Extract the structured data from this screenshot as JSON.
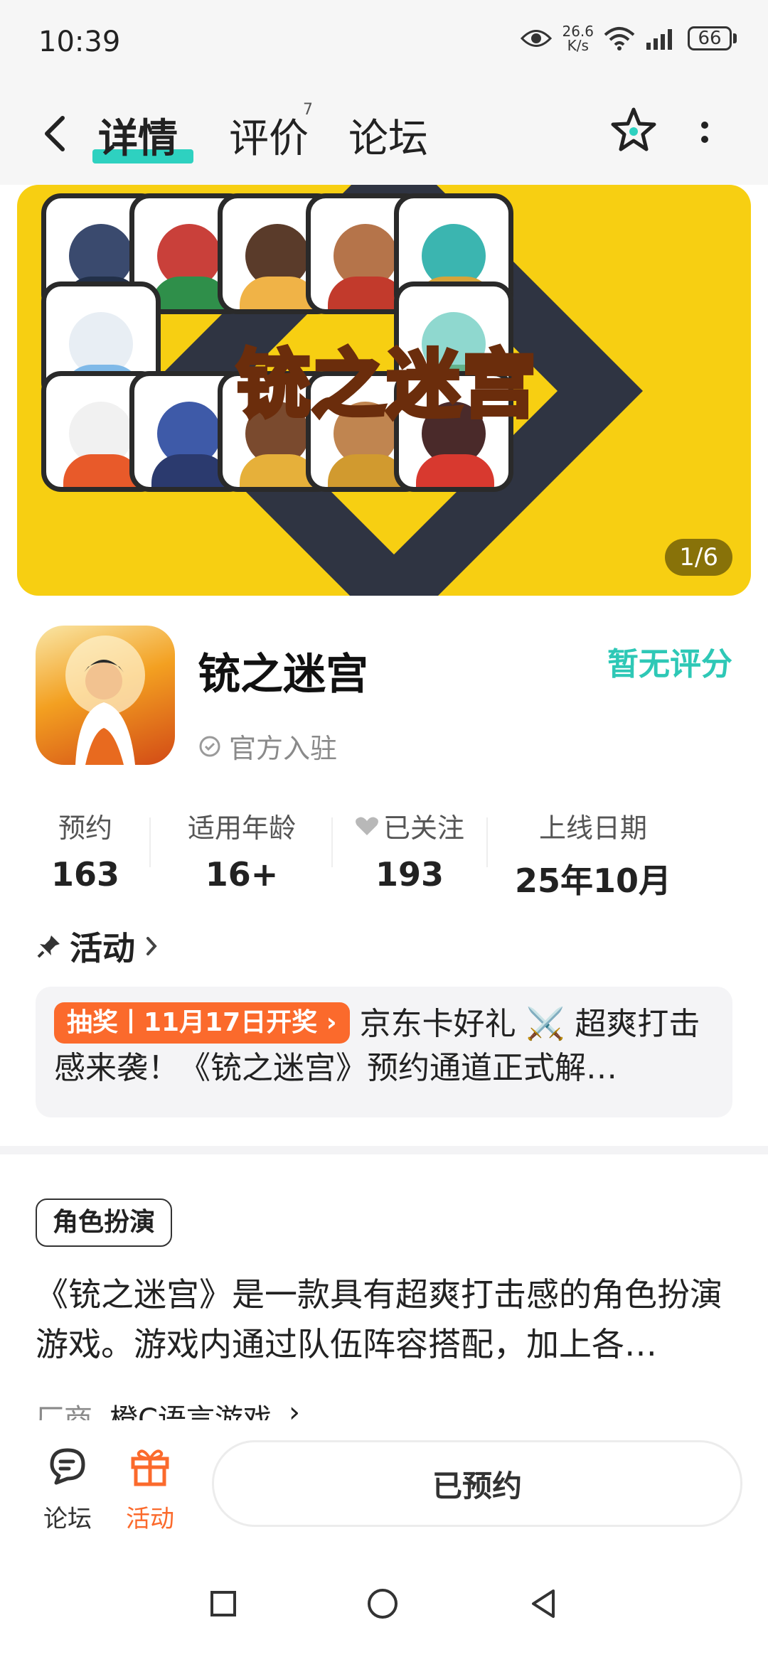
{
  "status_bar": {
    "time": "10:39",
    "net_speed_value": "26.6",
    "net_speed_unit": "K/s",
    "battery": "66"
  },
  "nav": {
    "tabs": [
      {
        "label": "详情",
        "active": true
      },
      {
        "label": "评价",
        "badge": "7"
      },
      {
        "label": "论坛"
      }
    ]
  },
  "banner": {
    "title": "铳之迷宫",
    "page_indicator": "1/6"
  },
  "app": {
    "name": "铳之迷宫",
    "rating": "暂无评分",
    "official_label": "官方入驻"
  },
  "stats": [
    {
      "label": "预约",
      "value": "163"
    },
    {
      "label": "适用年龄",
      "value": "16+"
    },
    {
      "label": "已关注",
      "value": "193"
    },
    {
      "label": "上线日期",
      "value": "25年10月"
    }
  ],
  "activity": {
    "header": "活动",
    "badge": "抽奖丨11月17日开奖",
    "text": "京东卡好礼 ⚔️ 超爽打击感来袭！《铳之迷宫》预约通道正式解…"
  },
  "description": {
    "genre": "角色扮演",
    "text": "《铳之迷宫》是一款具有超爽打击感的角色扮演游戏。游戏内通过队伍阵容搭配，加上各…",
    "publisher_label": "厂商",
    "publisher": "橙C语言游戏"
  },
  "bottom_bar": {
    "forum_label": "论坛",
    "activity_label": "活动",
    "reserve_label": "已预约"
  },
  "colors": {
    "accent_teal": "#2ed1c0",
    "activity_orange": "#fb6a2c",
    "banner_yellow": "#f7cf12"
  }
}
